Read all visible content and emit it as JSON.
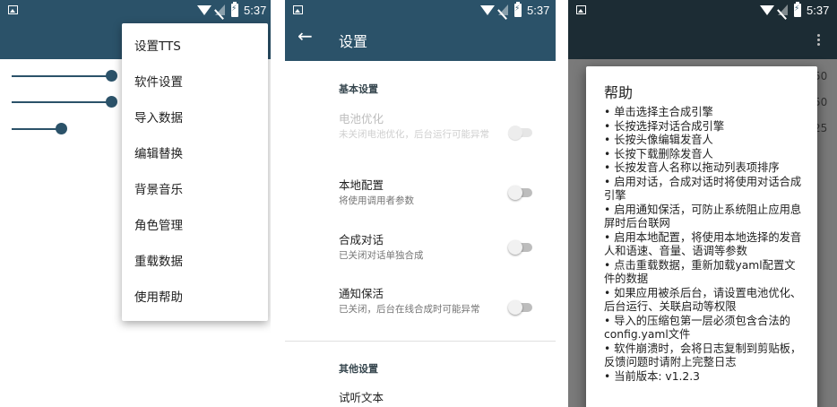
{
  "status_bar": {
    "time": "5:37"
  },
  "panel1": {
    "menu": [
      "设置TTS",
      "软件设置",
      "导入数据",
      "编辑替换",
      "背景音乐",
      "角色管理",
      "重载数据",
      "使用帮助"
    ]
  },
  "panel2": {
    "back_icon": "arrow-back-icon",
    "title": "设置",
    "section_basic": "基本设置",
    "prefs": [
      {
        "title": "电池优化",
        "summary": "未关闭电池优化，后台运行可能异常",
        "enabled": false,
        "on": false
      },
      {
        "title": "本地配置",
        "summary": "将使用调用者参数",
        "enabled": true,
        "on": false
      },
      {
        "title": "合成对话",
        "summary": "已关闭对话单独合成",
        "enabled": true,
        "on": false
      },
      {
        "title": "通知保活",
        "summary": "已关闭，后台在线合成时可能异常",
        "enabled": true,
        "on": false
      }
    ],
    "section_other": "其他设置",
    "pref_preview": "试听文本"
  },
  "panel3": {
    "bg_numbers": [
      "50",
      "50",
      "25"
    ],
    "dialog_title": "帮助",
    "help_items": [
      "单击选择主合成引擎",
      "长按选择对话合成引擎",
      "长按头像编辑发音人",
      "长按下载删除发音人",
      "长按发音人名称以拖动列表项排序",
      "启用对话，合成对话时将使用对话合成引擎",
      "启用通知保活，可防止系统阻止应用息屏时后台联网",
      "启用本地配置，将使用本地选择的发音人和语速、音量、语调等参数",
      "点击重载数据，重新加载yaml配置文件的数据",
      "如果应用被杀后台，请设置电池优化、后台运行、关联启动等权限",
      "导入的压缩包第一层必须包含合法的config.yaml文件",
      "软件崩溃时，会将日志复制到剪贴板，反馈问题时请附上完整日志",
      "当前版本: v1.2.3"
    ]
  },
  "colors": {
    "primary": "#2b5269",
    "primary_dark": "#1c2c34",
    "accent_text": "#37474f"
  }
}
